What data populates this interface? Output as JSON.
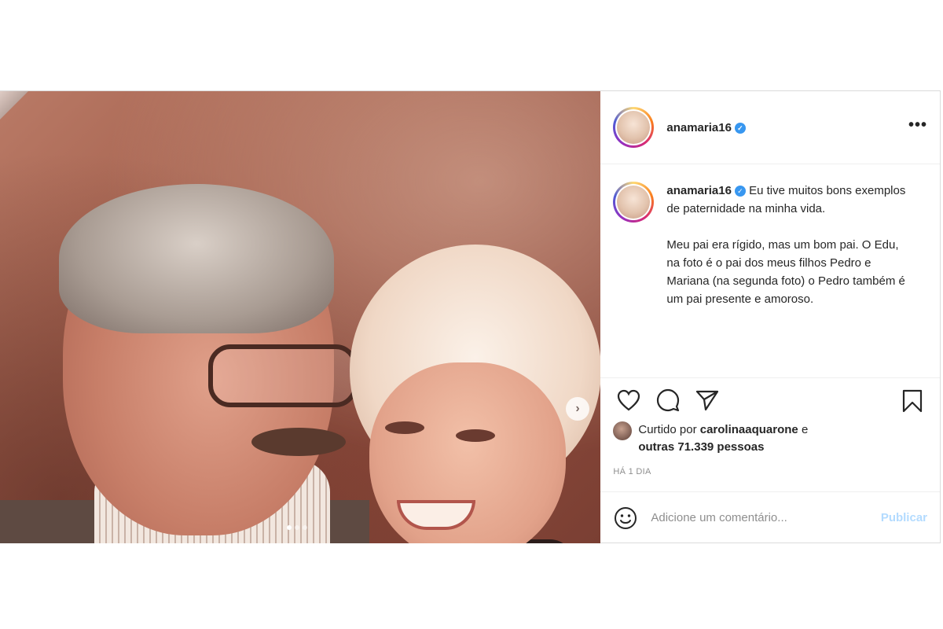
{
  "post": {
    "author": "anamaria16",
    "verified_mark": "✓",
    "more_menu": "•••",
    "caption": {
      "first_line": "Eu tive muitos bons exemplos de paternidade na minha vida.",
      "second_paragraph": "Meu pai era rígido, mas um bom pai. O Edu, na foto é o pai dos meus filhos Pedro e Mariana (na segunda foto) o Pedro também é um pai presente e amoroso."
    },
    "carousel": {
      "next_label": "›",
      "slide_count": 3,
      "active_slide": 1
    },
    "likes": {
      "prefix": "Curtido por",
      "liker": "carolinaaquarone",
      "connector": "e",
      "others": "outras 71.339 pessoas"
    },
    "timestamp": "HÁ 1 DIA",
    "comment": {
      "placeholder": "Adicione um comentário...",
      "publish_label": "Publicar"
    },
    "icons": {
      "like": "heart-icon",
      "comment": "comment-icon",
      "share": "paper-plane-icon",
      "save": "bookmark-icon",
      "emoji": "smiley-icon"
    },
    "colors": {
      "verified": "#3897f0",
      "publish": "#b3dbff",
      "muted": "#8e8e8e"
    }
  }
}
